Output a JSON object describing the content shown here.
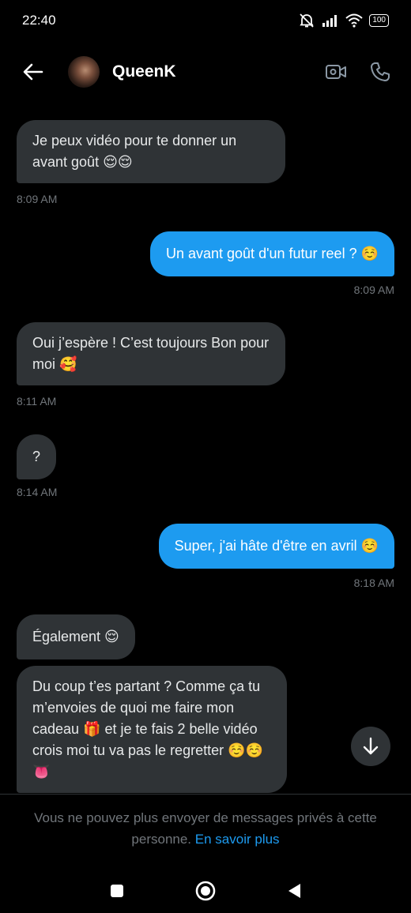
{
  "status_bar": {
    "time": "22:40",
    "battery": "100"
  },
  "header": {
    "contact_name": "QueenK"
  },
  "messages": [
    {
      "direction": "in",
      "text": "Je peux vidéo pour te donner un avant goût 😌😌",
      "time": "8:09 AM"
    },
    {
      "direction": "out",
      "text": "Un avant goût d'un futur reel ? ☺️",
      "time": "8:09 AM"
    },
    {
      "direction": "in",
      "text": "Oui j’espère ! C’est toujours Bon pour moi 🥰",
      "time": "8:11 AM"
    },
    {
      "direction": "in",
      "text": "?",
      "time": "8:14 AM"
    },
    {
      "direction": "out",
      "text": "Super, j'ai hâte d'être en avril ☺️",
      "time": "8:18 AM"
    },
    {
      "direction": "in",
      "text": "Également 😌",
      "time": ""
    },
    {
      "direction": "in",
      "text": "Du coup t’es partant ? Comme ça tu m’envoies de quoi me faire mon cadeau 🎁 et je te fais 2 belle vidéo crois moi tu va pas le regretter ☺️☺️👅",
      "time": ""
    }
  ],
  "footer": {
    "notice": "Vous ne pouvez plus envoyer de messages privés à cette personne.",
    "learn_more": "En savoir plus"
  },
  "colors": {
    "accent": "#1d9bf0",
    "incoming_bubble": "#2f3336",
    "background": "#000000"
  }
}
